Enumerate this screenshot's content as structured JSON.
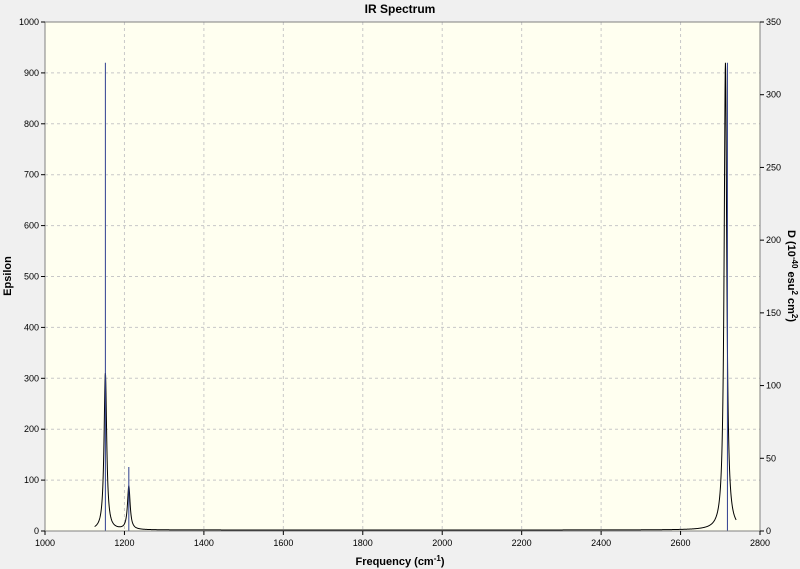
{
  "chart_data": {
    "type": "line",
    "title": "IR Spectrum",
    "xlabel": "Frequency (cm",
    "xlabel_sup": "-1",
    "xlabel_end": ")",
    "ylabel_left": "Epsilon",
    "ylabel_right_parts": [
      "D (10",
      "-40",
      " esu",
      "2",
      " cm",
      "2",
      ")"
    ],
    "xlim": [
      1000,
      2800
    ],
    "ylim_left": [
      0,
      1000
    ],
    "ylim_right": [
      0,
      350
    ],
    "x_ticks": [
      1000,
      1200,
      1400,
      1600,
      1800,
      2000,
      2200,
      2400,
      2600,
      2800
    ],
    "y_ticks_left": [
      0,
      100,
      200,
      300,
      400,
      500,
      600,
      700,
      800,
      900,
      1000
    ],
    "y_ticks_right": [
      0,
      50,
      100,
      150,
      200,
      250,
      300,
      350
    ],
    "grid": true,
    "x_reversed": false,
    "series": [
      {
        "axis": "left",
        "kind": "lorentzian-spectrum",
        "peaks": [
          {
            "x": 1152,
            "y": 310
          },
          {
            "x": 1211,
            "y": 87
          },
          {
            "x": 2713,
            "y": 920
          }
        ],
        "baseline": 2,
        "hwhm": 4,
        "x_range": [
          1125,
          2740
        ]
      },
      {
        "axis": "right",
        "kind": "sticks",
        "sticks": [
          {
            "x": 1152,
            "y": 322
          },
          {
            "x": 1211,
            "y": 44
          },
          {
            "x": 2718,
            "y": 322
          }
        ]
      }
    ]
  },
  "colors": {
    "plot_background": "#fffff0",
    "spectrum_line": "#000000",
    "stick_line": "#2f3f8f",
    "grid": "#c8c8c8",
    "frame": "#808080",
    "window_background": "#f0f0f0"
  }
}
